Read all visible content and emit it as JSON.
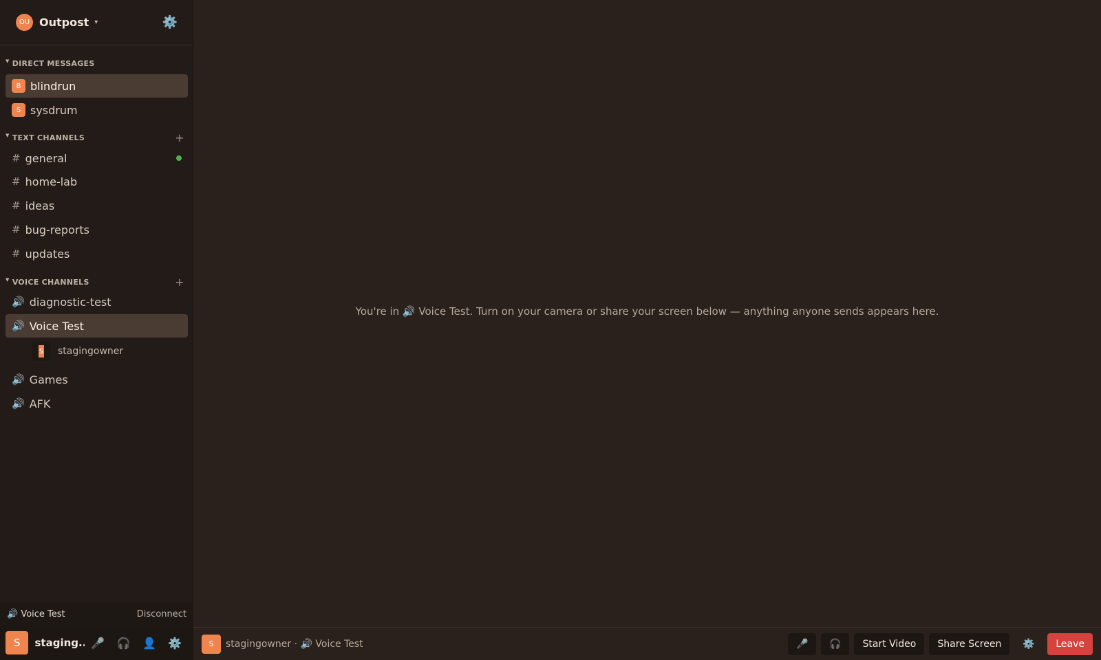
{
  "server": {
    "avatar_initials": "OU",
    "name": "Outpost",
    "caret": "▾",
    "settings_icon": "⚙️"
  },
  "direct_messages": {
    "header": "DIRECT MESSAGES",
    "items": [
      {
        "initial": "B",
        "name": "blindrun",
        "active": true
      },
      {
        "initial": "S",
        "name": "sysdrum",
        "active": false
      }
    ]
  },
  "text_channels": {
    "header": "TEXT CHANNELS",
    "add": "+",
    "items": [
      {
        "name": "general",
        "unread": true
      },
      {
        "name": "home-lab"
      },
      {
        "name": "ideas"
      },
      {
        "name": "bug-reports"
      },
      {
        "name": "updates"
      }
    ]
  },
  "voice_channels": {
    "header": "VOICE CHANNELS",
    "add": "+",
    "items": [
      {
        "name": "diagnostic-test"
      },
      {
        "name": "Voice Test",
        "active": true
      },
      {
        "name": "Games"
      },
      {
        "name": "AFK"
      }
    ],
    "connected_user": {
      "initial": "S",
      "name": "stagingowner"
    }
  },
  "icons": {
    "hash": "#",
    "speaker": "🔊",
    "mic": "🎤",
    "headphones": "🎧",
    "user": "👤",
    "gear": "⚙️"
  },
  "voice_status": {
    "channel": "🔊 Voice Test",
    "disconnect": "Disconnect"
  },
  "user_bar": {
    "initial": "S",
    "name": "staging..."
  },
  "main": {
    "empty_message": "You're in 🔊 Voice Test. Turn on your camera or share your screen below — anything anyone sends appears here."
  },
  "bottom_bar": {
    "initial": "S",
    "status_text": "stagingowner · 🔊 Voice Test",
    "start_video": "Start Video",
    "share_screen": "Share Screen",
    "leave": "Leave"
  },
  "colors": {
    "accent": "#f0844e",
    "leave": "#d5433e",
    "online": "#4caf50"
  }
}
